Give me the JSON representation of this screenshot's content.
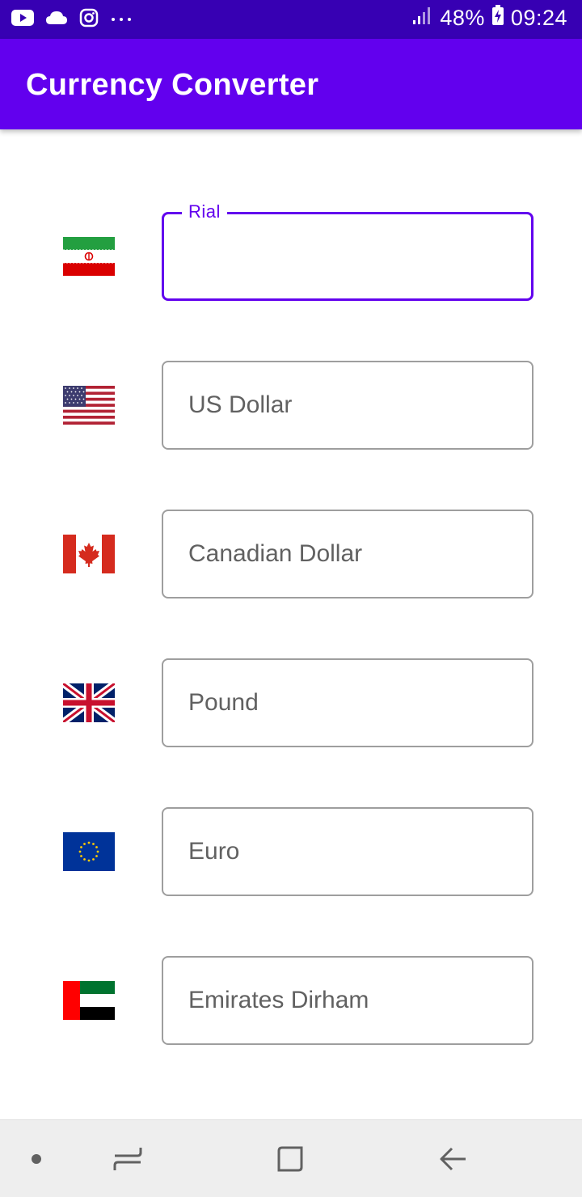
{
  "status_bar": {
    "battery": "48%",
    "time": "09:24",
    "left_icons": [
      "youtube-icon",
      "cloud-icon",
      "instagram-icon",
      "more-notifications-icon"
    ]
  },
  "app_bar": {
    "title": "Currency Converter",
    "color": "#6200ee"
  },
  "converter": {
    "rows": [
      {
        "flag": "iran-flag",
        "label": "Rial",
        "value": "",
        "focused": true
      },
      {
        "flag": "usa-flag",
        "label": "US Dollar",
        "value": "",
        "focused": false
      },
      {
        "flag": "canada-flag",
        "label": "Canadian Dollar",
        "value": "",
        "focused": false
      },
      {
        "flag": "uk-flag",
        "label": "Pound",
        "value": "",
        "focused": false
      },
      {
        "flag": "eu-flag",
        "label": "Euro",
        "value": "",
        "focused": false
      },
      {
        "flag": "uae-flag",
        "label": "Emirates Dirham",
        "value": "",
        "focused": false
      }
    ]
  },
  "nav_bar": {
    "buttons": [
      "dot-icon",
      "recent-apps-icon",
      "home-icon",
      "back-icon"
    ]
  }
}
